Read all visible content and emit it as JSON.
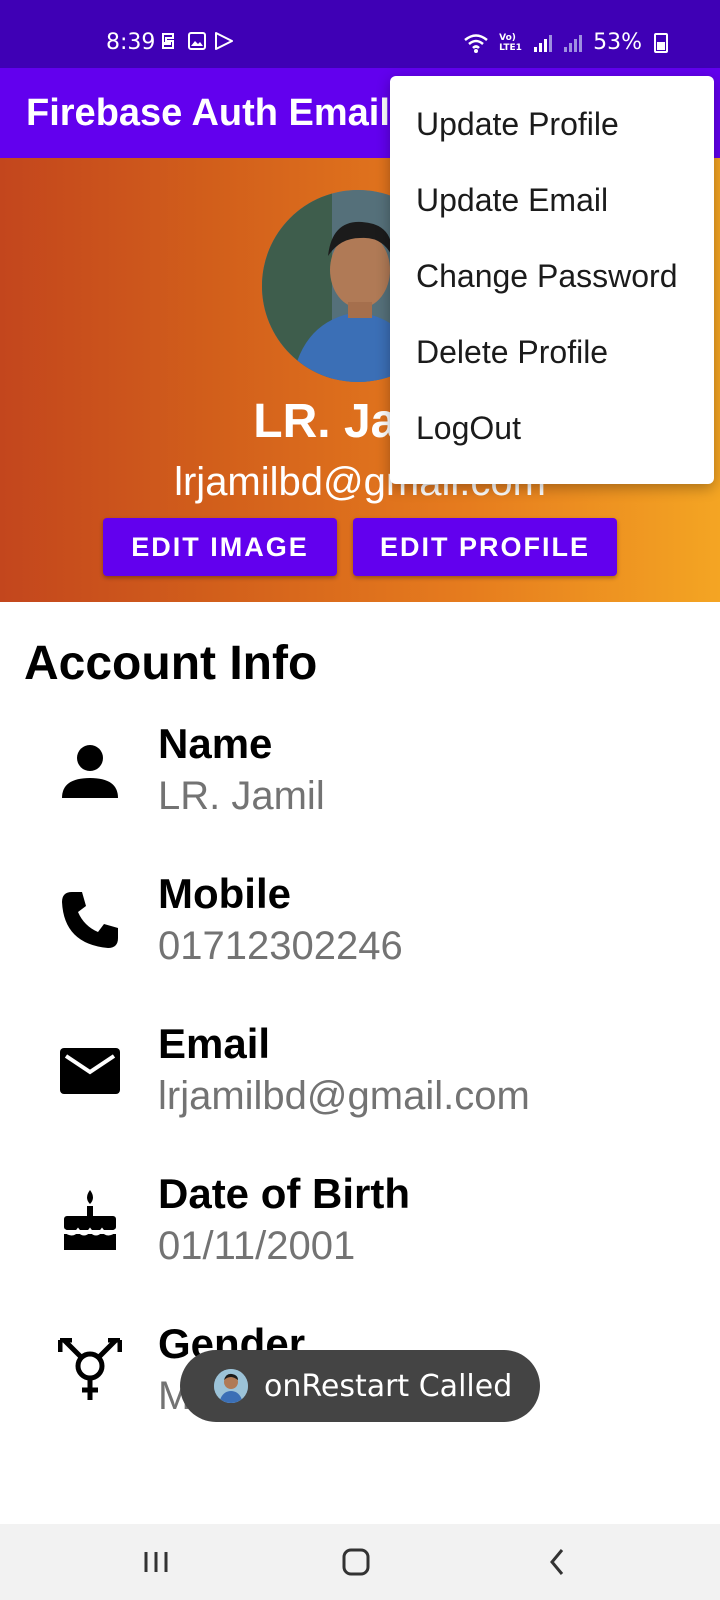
{
  "status_bar": {
    "time": "8:39",
    "network_label": "Vo) LTE1",
    "battery": "53%"
  },
  "app_bar": {
    "title": "Firebase Auth Email"
  },
  "profile": {
    "name": "LR. Jamil",
    "email": "lrjamilbd@gmail.com",
    "edit_image_label": "EDIT IMAGE",
    "edit_profile_label": "EDIT PROFILE"
  },
  "account_info": {
    "title": "Account Info",
    "items": [
      {
        "label": "Name",
        "value": "LR. Jamil",
        "icon": "person-icon"
      },
      {
        "label": "Mobile",
        "value": "01712302246",
        "icon": "phone-icon"
      },
      {
        "label": "Email",
        "value": "lrjamilbd@gmail.com",
        "icon": "mail-icon"
      },
      {
        "label": "Date of Birth",
        "value": "01/11/2001",
        "icon": "cake-icon"
      },
      {
        "label": "Gender",
        "value": "Male",
        "icon": "gender-icon"
      }
    ]
  },
  "menu": {
    "items": [
      "Update Profile",
      "Update Email",
      "Change Password",
      "Delete Profile",
      "LogOut"
    ]
  },
  "toast": {
    "text": "onRestart Called"
  },
  "colors": {
    "status_bar": "#3f00b5",
    "app_bar": "#6200ee",
    "button": "#6200ee",
    "gradient_start": "#c3461d",
    "gradient_end": "#f4a523",
    "value_text": "#737373"
  }
}
